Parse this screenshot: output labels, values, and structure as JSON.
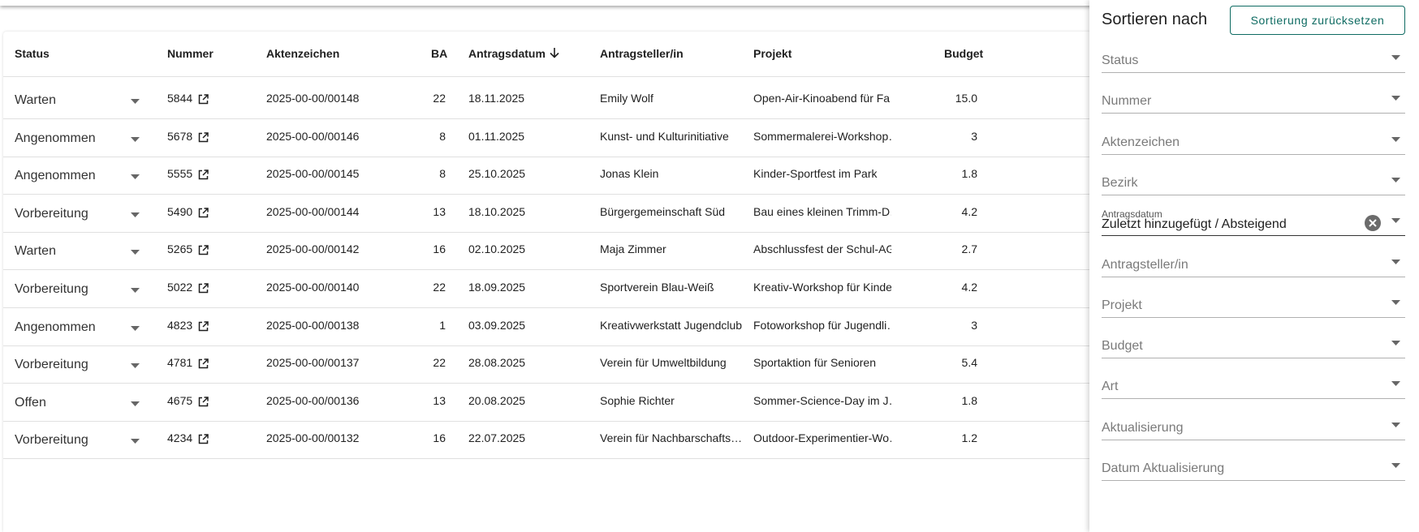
{
  "table": {
    "headers": {
      "status": "Status",
      "nummer": "Nummer",
      "aktenzeichen": "Aktenzeichen",
      "ba": "BA",
      "antragsdatum": "Antragsdatum",
      "antragsteller": "Antragsteller/in",
      "projekt": "Projekt",
      "budget": "Budget"
    },
    "rows": [
      {
        "status": "Warten",
        "nummer": "5844",
        "aktenzeichen": "2025-00-00/00148",
        "ba": "22",
        "datum": "18.11.2025",
        "antragsteller": "Emily Wolf",
        "projekt": "Open-Air-Kinoabend für Fa…",
        "budget": "15.0"
      },
      {
        "status": "Angenommen",
        "nummer": "5678",
        "aktenzeichen": "2025-00-00/00146",
        "ba": "8",
        "datum": "01.11.2025",
        "antragsteller": "Kunst- und Kulturinitiative",
        "projekt": "Sommermalerei-Workshop…",
        "budget": "3"
      },
      {
        "status": "Angenommen",
        "nummer": "5555",
        "aktenzeichen": "2025-00-00/00145",
        "ba": "8",
        "datum": "25.10.2025",
        "antragsteller": "Jonas Klein",
        "projekt": "Kinder-Sportfest im Park",
        "budget": "1.8"
      },
      {
        "status": "Vorbereitung",
        "nummer": "5490",
        "aktenzeichen": "2025-00-00/00144",
        "ba": "13",
        "datum": "18.10.2025",
        "antragsteller": "Bürgergemeinschaft Süd",
        "projekt": "Bau eines kleinen Trimm-D…",
        "budget": "4.2"
      },
      {
        "status": "Warten",
        "nummer": "5265",
        "aktenzeichen": "2025-00-00/00142",
        "ba": "16",
        "datum": "02.10.2025",
        "antragsteller": "Maja Zimmer",
        "projekt": "Abschlussfest der Schul-AG",
        "budget": "2.7"
      },
      {
        "status": "Vorbereitung",
        "nummer": "5022",
        "aktenzeichen": "2025-00-00/00140",
        "ba": "22",
        "datum": "18.09.2025",
        "antragsteller": "Sportverein Blau-Weiß",
        "projekt": "Kreativ-Workshop für Kinder",
        "budget": "4.2"
      },
      {
        "status": "Angenommen",
        "nummer": "4823",
        "aktenzeichen": "2025-00-00/00138",
        "ba": "1",
        "datum": "03.09.2025",
        "antragsteller": "Kreativwerkstatt Jugendclub",
        "projekt": "Fotoworkshop für Jugendli…",
        "budget": "3"
      },
      {
        "status": "Vorbereitung",
        "nummer": "4781",
        "aktenzeichen": "2025-00-00/00137",
        "ba": "22",
        "datum": "28.08.2025",
        "antragsteller": "Verein für Umweltbildung",
        "projekt": "Sportaktion für Senioren",
        "budget": "5.4"
      },
      {
        "status": "Offen",
        "nummer": "4675",
        "aktenzeichen": "2025-00-00/00136",
        "ba": "13",
        "datum": "20.08.2025",
        "antragsteller": "Sophie Richter",
        "projekt": "Sommer-Science-Day im J…",
        "budget": "1.8"
      },
      {
        "status": "Vorbereitung",
        "nummer": "4234",
        "aktenzeichen": "2025-00-00/00132",
        "ba": "16",
        "datum": "22.07.2025",
        "antragsteller": "Verein für Nachbarschafts…",
        "projekt": "Outdoor-Experimentier-Wo…",
        "budget": "1.2"
      }
    ]
  },
  "sort_panel": {
    "title": "Sortieren nach",
    "reset_label": "Sortierung zurücksetzen",
    "fields": [
      {
        "label": "Status"
      },
      {
        "label": "Nummer"
      },
      {
        "label": "Aktenzeichen"
      },
      {
        "label": "Bezirk"
      },
      {
        "label": "Antragsdatum",
        "value": "Zuletzt hinzugefügt / Absteigend",
        "active": true
      },
      {
        "label": "Antragsteller/in"
      },
      {
        "label": "Projekt"
      },
      {
        "label": "Budget"
      },
      {
        "label": "Art"
      },
      {
        "label": "Aktualisierung"
      },
      {
        "label": "Datum Aktualisierung"
      }
    ]
  },
  "icons": {
    "sort_direction": "arrow-down-icon",
    "status_dropdown": "caret-down-icon",
    "open_external": "open-in-new-icon",
    "clear_value": "close-circle-icon"
  },
  "colors": {
    "accent": "#0e6b62",
    "divider": "#e0e0e0"
  }
}
